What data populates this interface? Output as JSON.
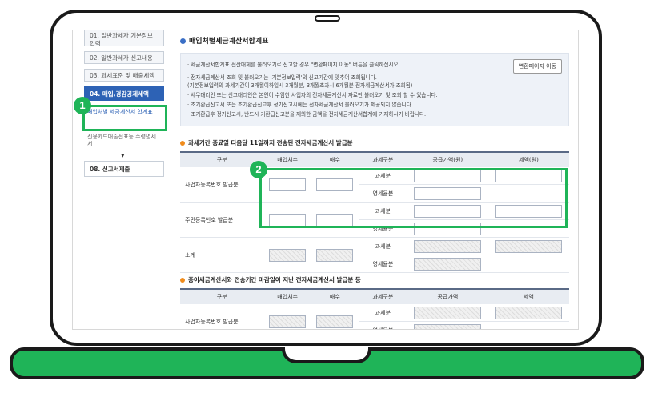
{
  "sidebar": {
    "items": [
      {
        "label": "01. 일반과세자 기본정보 입력"
      },
      {
        "label": "02. 일반과세자 신고내용"
      },
      {
        "label": "03. 과세표준 및 매출세액"
      },
      {
        "label": "04. 매입,경감공제세액"
      },
      {
        "label": "08. 신고서제출"
      }
    ],
    "sub_items": [
      {
        "label": "매입처별 세금계산서 합계표"
      },
      {
        "label": "신용카드매출전표등 수령명세서"
      }
    ]
  },
  "main": {
    "title": "매입처별세금계산서합계표",
    "notes": [
      "· 세금계산서합계표 전산매체를 불러오기로 신고할 경우 \"변환페이지 이동\" 버튼을 클릭하십시오.",
      "· 전자세금계산서 조회 및 불러오기는 '기본정보입력'의 신고기간에 맞추어 조회됩니다.",
      "(기본정보입력의 과세기간이 3개월이하일시 3개월분, 3개월초과시 6개월분 전자세금계산서가 조회됨)",
      "· 세무대리인 또는 신고대리인은 본인이 수임한 사업자의 전자세금계산서 자료만 불러오기 및 조회 할 수 있습니다.",
      "· 조기환급신고서 또는 조기환급신고후 정기신고시에는 전자세금계산서 불러오기가 제공되지 않습니다.",
      "· 조기환급후 정기신고시, 반드시 기환급신고분을 제외한 금액을 전자세금계산서합계에 기재하시기 바랍니다."
    ],
    "move_button": "변환페이지 이동",
    "section1_title": "과세기간 종료일 다음달 11일까지 전송된 전자세금계산서 발급분",
    "section2_title": "종이세금계산서와 전송기간 마감일이 지난 전자세금계산서 발급분 등",
    "table1_headers": [
      "구분",
      "매입처수",
      "매수",
      "과세구분",
      "공급가액(원)",
      "세액(원)"
    ],
    "table2_headers": [
      "구분",
      "매입처수",
      "매수",
      "과세구분",
      "공급가액",
      "세액"
    ],
    "row_labels": [
      "사업자등록번호 발급분",
      "주민등록번호 발급분",
      "소계"
    ],
    "tax_types": [
      "과세분",
      "영세율분"
    ]
  },
  "callouts": [
    "1",
    "2"
  ],
  "colors": {
    "accent": "#1fb458",
    "menu_active": "#2d62b5"
  }
}
